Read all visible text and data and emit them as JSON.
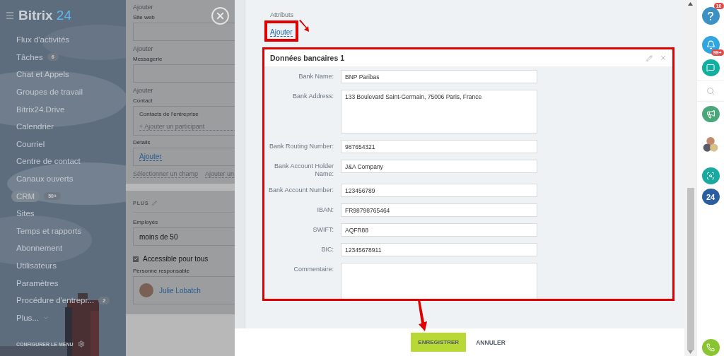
{
  "sidebar": {
    "logo": {
      "name": "Bitrix",
      "number": "24"
    },
    "items": [
      {
        "label": "Flux d'activités",
        "selected": false
      },
      {
        "label": "Tâches",
        "badge": "6",
        "selected": false
      },
      {
        "label": "Chat et Appels",
        "selected": false
      },
      {
        "label": "Groupes de travail",
        "selected": false
      },
      {
        "label": "Bitrix24.Drive",
        "selected": false
      },
      {
        "label": "Calendrier",
        "selected": false
      },
      {
        "label": "Courriel",
        "selected": false
      },
      {
        "label": "Centre de contact",
        "selected": false
      },
      {
        "label": "Canaux ouverts",
        "selected": false
      },
      {
        "label": "CRM",
        "badge": "50+",
        "selected": true
      },
      {
        "label": "Sites",
        "selected": false
      },
      {
        "label": "Temps et rapports",
        "selected": false
      },
      {
        "label": "Abonnement",
        "selected": false
      },
      {
        "label": "Utilisateurs",
        "selected": false
      },
      {
        "label": "Paramètres",
        "selected": false
      },
      {
        "label": "Procédure d'entrepr...",
        "badge": "2",
        "selected": false
      },
      {
        "label": "Plus...",
        "kind": "more",
        "selected": false
      }
    ],
    "configure": "CONFIGURER LE MENU"
  },
  "entity_form": {
    "items": [
      {
        "kind": "add",
        "text": "Ajouter"
      },
      {
        "kind": "field",
        "label": "Site web"
      },
      {
        "kind": "add",
        "text": "Ajouter"
      },
      {
        "kind": "field",
        "label": "Messagerie"
      },
      {
        "kind": "add",
        "text": "Ajouter"
      },
      {
        "kind": "contact",
        "label": "Contact",
        "placeholder": "Contacts de l'entreprise",
        "action": "+ Ajouter un participant"
      },
      {
        "kind": "details",
        "label": "Détails",
        "link": "Ajouter"
      },
      {
        "kind": "links",
        "links": [
          "Sélectionner un champ",
          "Ajouter un"
        ]
      }
    ],
    "section": {
      "title": "PLUS",
      "fields": [
        {
          "kind": "select",
          "label": "Employés",
          "value": "moins de 50"
        },
        {
          "kind": "checkbox",
          "label": "Accessible pour tous",
          "checked": true
        },
        {
          "kind": "person",
          "label": "Personne responsable",
          "name": "Julie Lobatch"
        }
      ]
    }
  },
  "slider": {
    "section_label": "Attributs",
    "add_link": "Ajouter",
    "card": {
      "title": "Données bancaires 1",
      "fields": [
        {
          "label": "Bank Name:",
          "value": "BNP Paribas",
          "kind": "input"
        },
        {
          "label": "Bank Address:",
          "value": "133 Boulevard Saint-Germain, 75006 Paris, France",
          "kind": "textarea"
        },
        {
          "label": "Bank Routing Number:",
          "value": "987654321",
          "kind": "input"
        },
        {
          "label": "Bank Account Holder Name:",
          "value": "J&A Company",
          "kind": "input"
        },
        {
          "label": "Bank Account Number:",
          "value": "123456789",
          "kind": "input"
        },
        {
          "label": "IBAN:",
          "value": "FR98798765464",
          "kind": "input"
        },
        {
          "label": "SWIFT:",
          "value": "AQFR88",
          "kind": "input"
        },
        {
          "label": "BIC:",
          "value": "12345678911",
          "kind": "input"
        },
        {
          "label": "Commentaire:",
          "kind": "textarea-cut"
        }
      ]
    },
    "footer": {
      "save": "ENREGISTRER",
      "cancel": "ANNULER"
    }
  },
  "right_bar": {
    "help_badge": "10",
    "notifications_badge": "99+",
    "app_label": "24"
  }
}
